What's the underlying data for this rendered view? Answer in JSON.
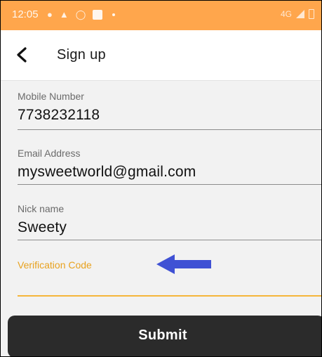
{
  "status_bar": {
    "time": "12:05",
    "network": "4G"
  },
  "header": {
    "back_icon": "chevron-left-icon",
    "title": "Sign up"
  },
  "form": {
    "fields": [
      {
        "label": "Mobile Number",
        "value": "7738232118"
      },
      {
        "label": "Email Address",
        "value": "mysweetworld@gmail.com"
      },
      {
        "label": "Nick name",
        "value": "Sweety"
      },
      {
        "label": "Verification Code",
        "value": ""
      }
    ],
    "submit_label": "Submit"
  },
  "colors": {
    "status_bar": "#ffa64c",
    "active_field": "#f5b63a",
    "arrow": "#3f51d4",
    "submit_bg": "#2b2b2b"
  }
}
